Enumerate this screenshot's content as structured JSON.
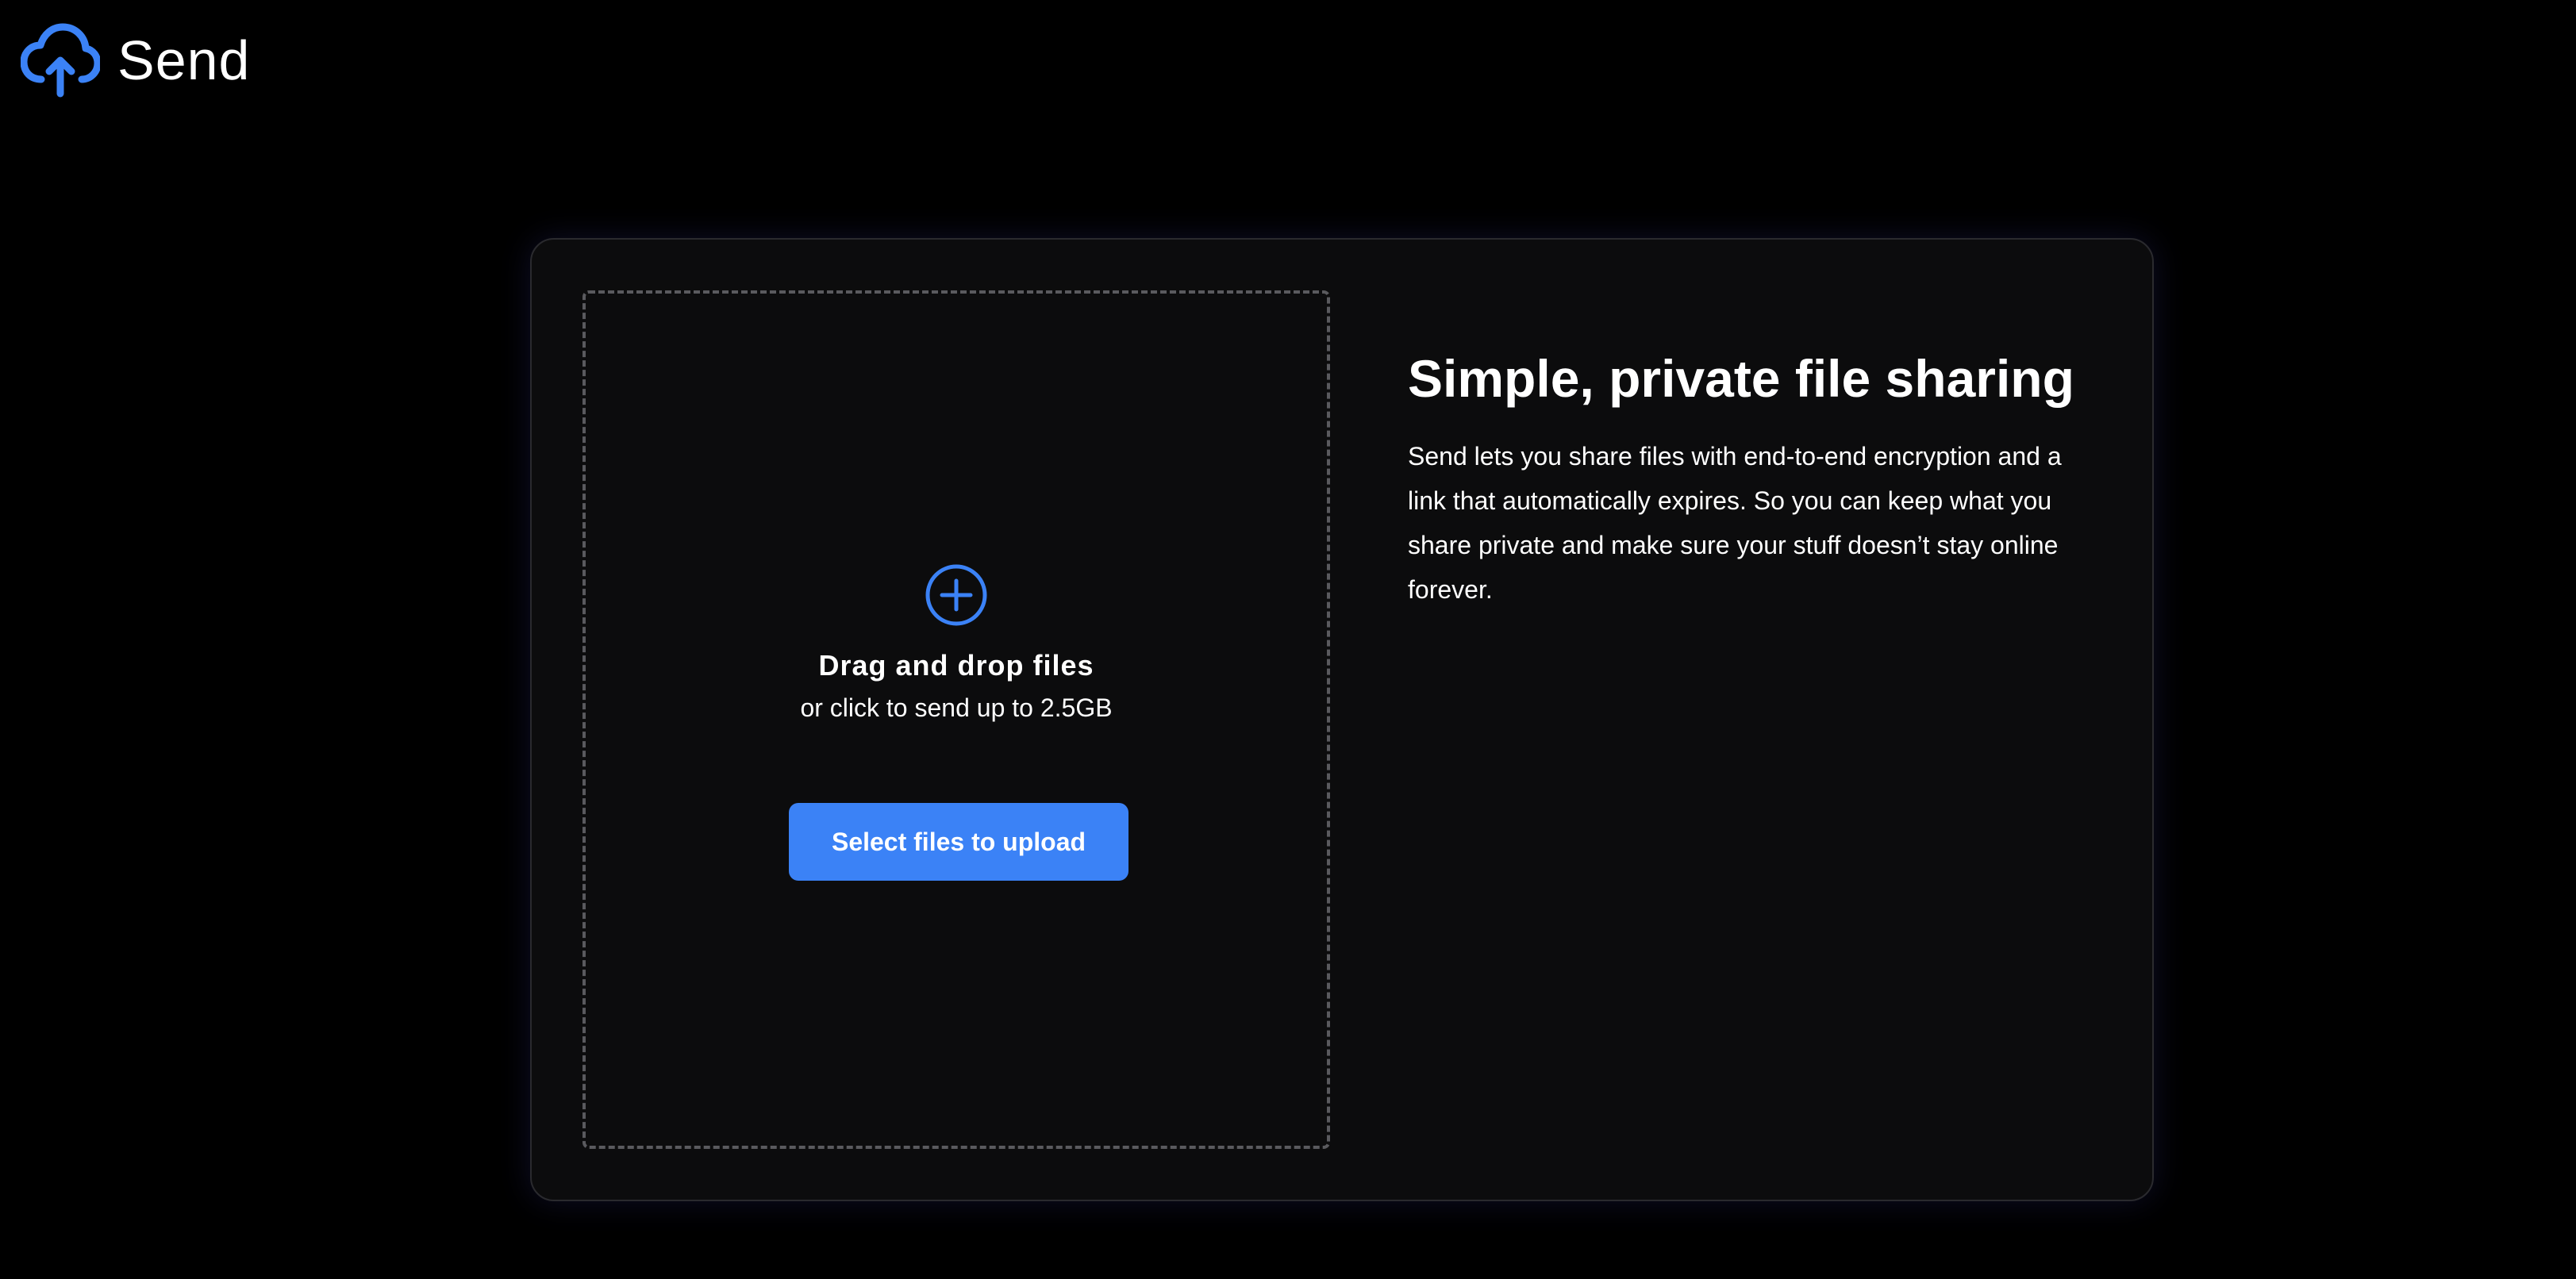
{
  "header": {
    "app_name": "Send",
    "logo_icon": "cloud-upload-icon",
    "accent_color": "#3b82f6"
  },
  "upload": {
    "add_icon": "plus-circle-icon",
    "title": "Drag and drop files",
    "subtitle": "or click to send up to 2.5GB",
    "button_label": "Select files to upload"
  },
  "info": {
    "title": "Simple, private file sharing",
    "description": "Send lets you share files with end-to-end encryption and a link that automatically expires. So you can keep what you share private and make sure your stuff doesn’t stay online forever."
  }
}
